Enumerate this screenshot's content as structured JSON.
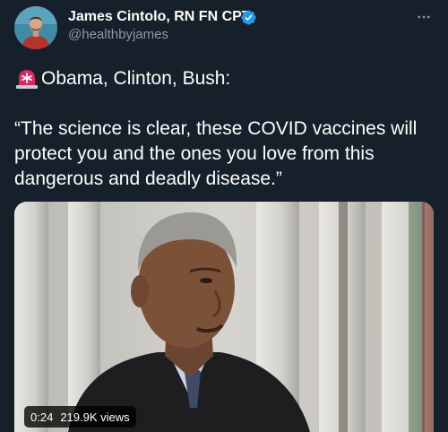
{
  "author": {
    "name": "James Cintolo, RN FN CPT",
    "handle": "@healthbyjames",
    "verified_color": "#1d9bf0"
  },
  "tweet": {
    "line1": "Obama, Clinton, Bush:",
    "quote": "“The science is clear, these COVID vaccines will protect you and the ones you love from this dangerous and deadly disease.”",
    "emoji": "rotating-light-icon"
  },
  "video": {
    "timestamp": "0:24",
    "views": "219.9K views"
  },
  "colors": {
    "background": "#15202b",
    "secondary_text": "#8b98a5",
    "accent": "#1d9bf0"
  }
}
